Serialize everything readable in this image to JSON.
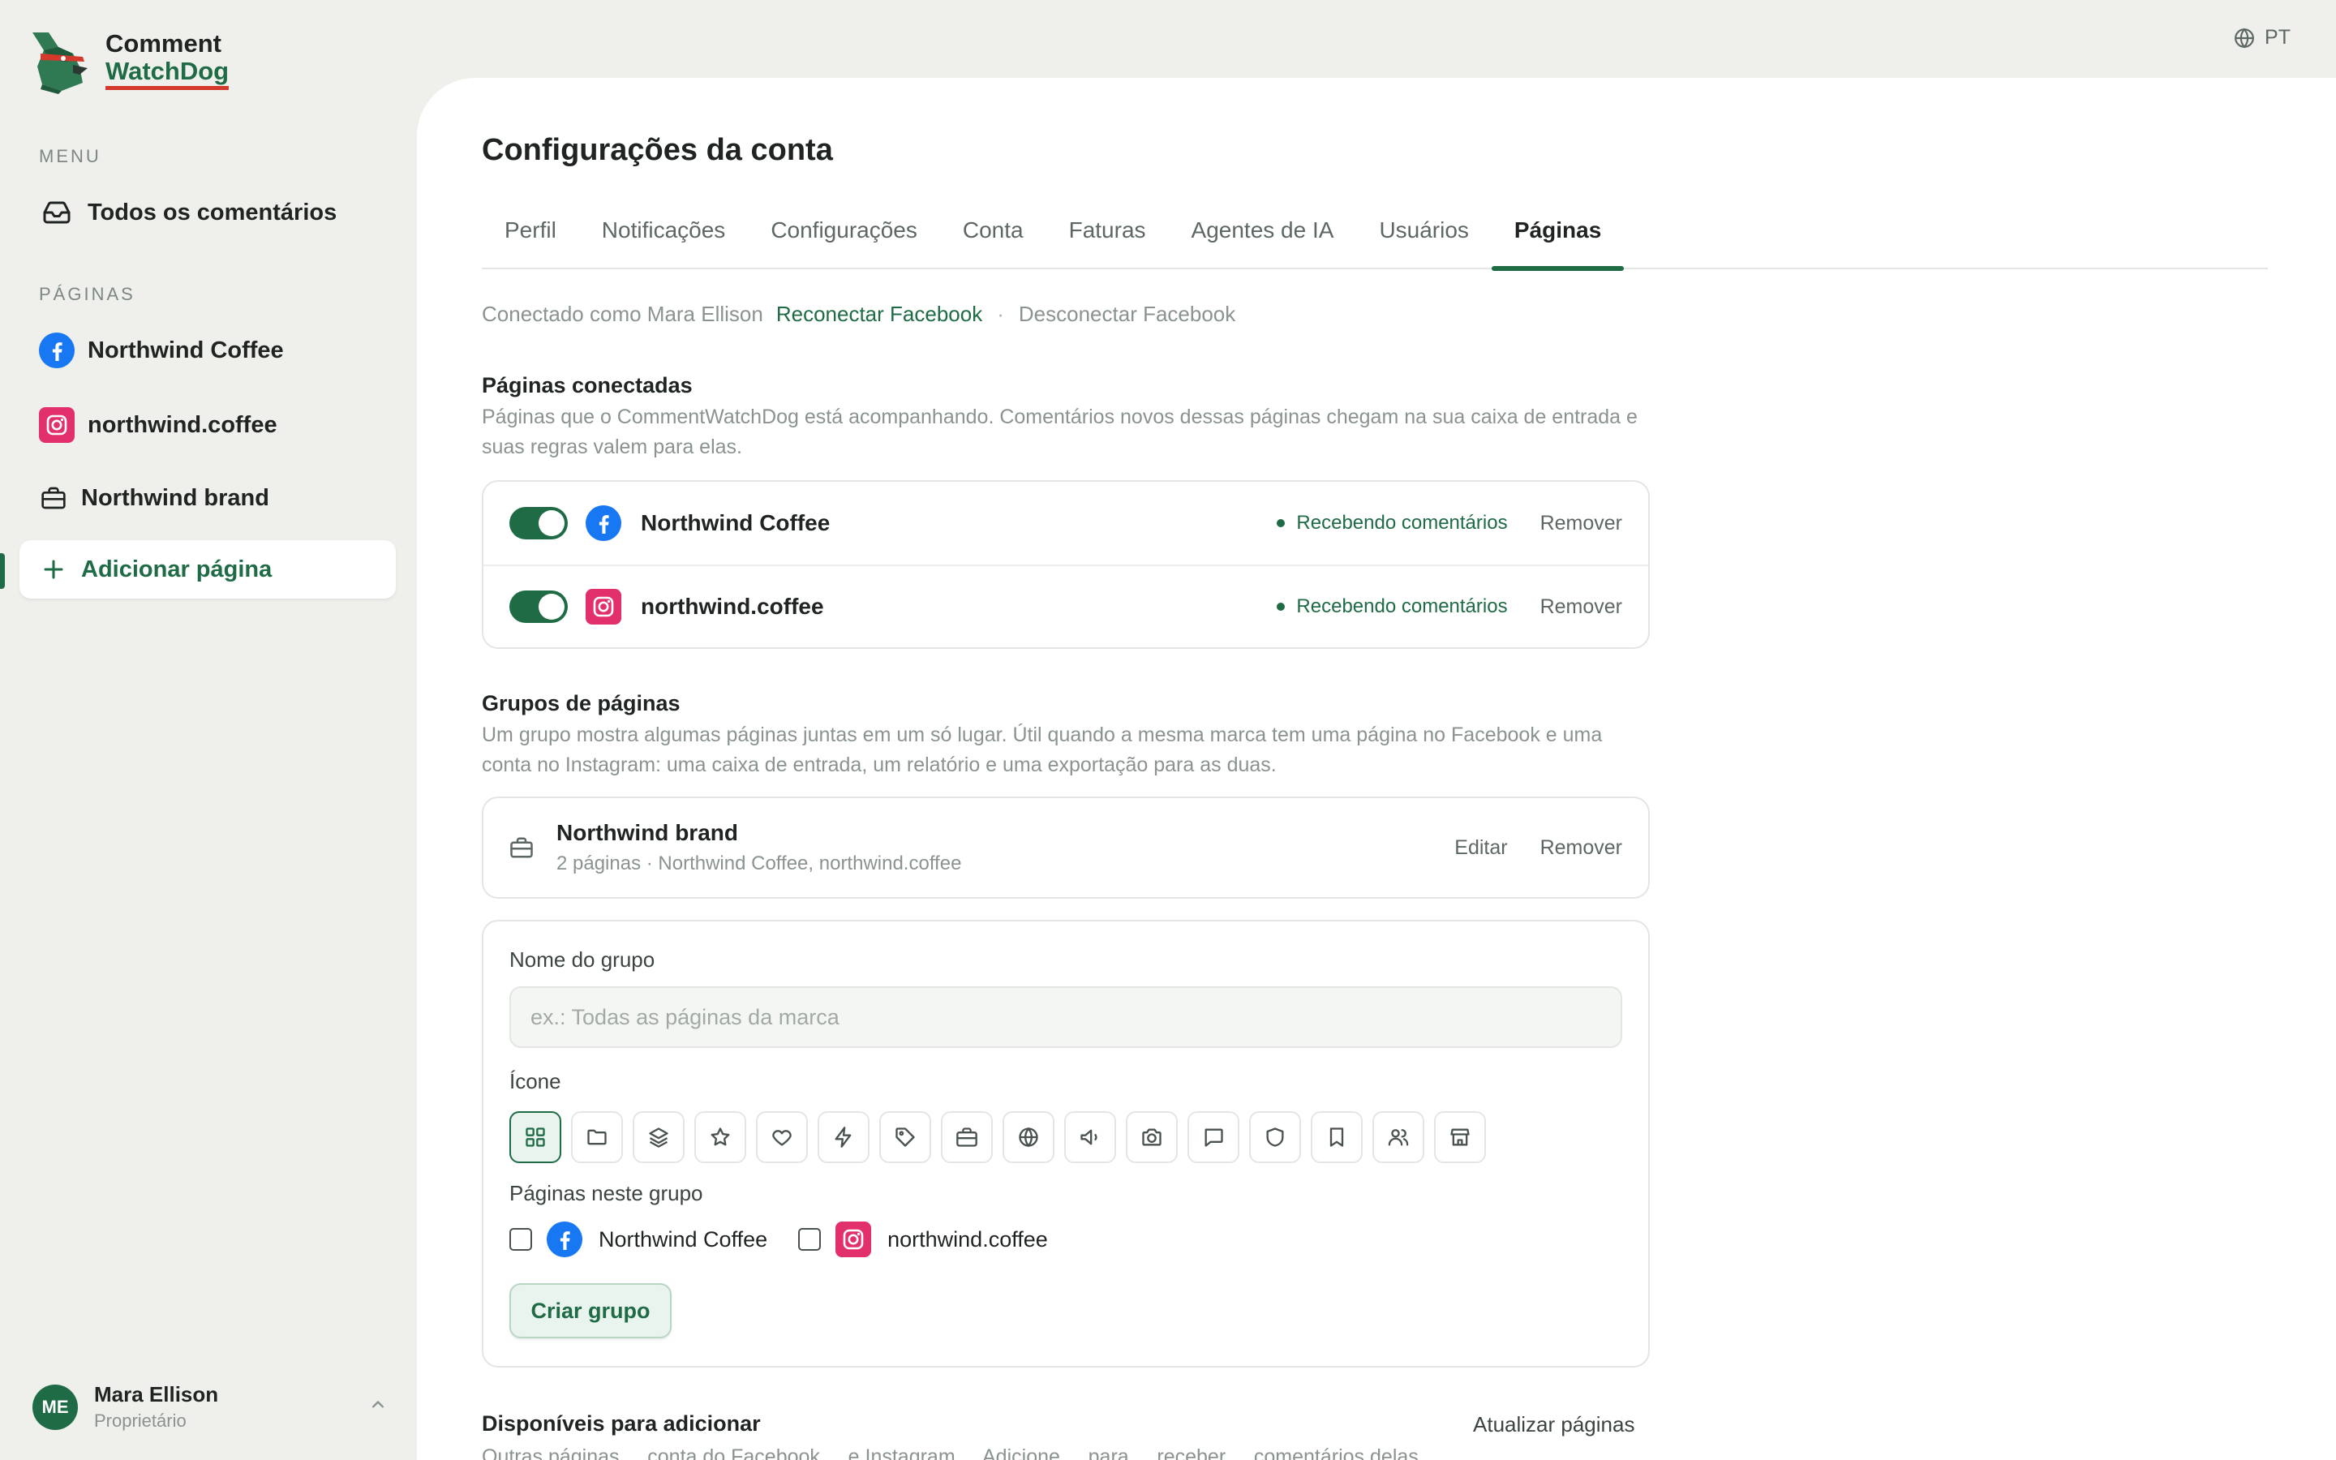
{
  "brand": {
    "line1": "Comment",
    "line2": "WatchDog"
  },
  "language": "PT",
  "sidebar": {
    "menu_label": "MENU",
    "all_comments": "Todos os comentários",
    "pages_label": "PÁGINAS",
    "pages": [
      {
        "label": "Northwind Coffee",
        "icon": "facebook-icon"
      },
      {
        "label": "northwind.coffee",
        "icon": "instagram-icon"
      },
      {
        "label": "Northwind brand",
        "icon": "briefcase-icon"
      }
    ],
    "add_page": "Adicionar página"
  },
  "user": {
    "initials": "ME",
    "name": "Mara Ellison",
    "role": "Proprietário"
  },
  "main": {
    "title": "Configurações da conta",
    "tabs": [
      {
        "label": "Perfil"
      },
      {
        "label": "Notificações"
      },
      {
        "label": "Configurações"
      },
      {
        "label": "Conta"
      },
      {
        "label": "Faturas"
      },
      {
        "label": "Agentes de IA"
      },
      {
        "label": "Usuários"
      },
      {
        "label": "Páginas",
        "active": true
      }
    ],
    "connection": {
      "text": "Conectado como Mara Ellison",
      "reconnect": "Reconectar Facebook",
      "separator": "·",
      "disconnect": "Desconectar Facebook"
    },
    "connected": {
      "title": "Páginas conectadas",
      "description": "Páginas que o CommentWatchDog está acompanhando. Comentários novos dessas páginas chegam na sua caixa de entrada e suas regras valem para elas.",
      "pages": [
        {
          "name": "Northwind Coffee",
          "platform": "facebook",
          "status": "Recebendo comentários",
          "remove": "Remover"
        },
        {
          "name": "northwind.coffee",
          "platform": "instagram",
          "status": "Recebendo comentários",
          "remove": "Remover"
        }
      ]
    },
    "groups": {
      "title": "Grupos de páginas",
      "description": "Um grupo mostra algumas páginas juntas em um só lugar. Útil quando a mesma marca tem uma página no Facebook e uma conta no Instagram: uma caixa de entrada, um relatório e uma exportação para as duas.",
      "items": [
        {
          "name": "Northwind brand",
          "subtitle": "2 páginas · Northwind Coffee, northwind.coffee",
          "edit": "Editar",
          "remove": "Remover"
        }
      ],
      "form": {
        "name_label": "Nome do grupo",
        "name_placeholder": "ex.: Todas as páginas da marca",
        "icon_label": "Ícone",
        "icons": [
          "grid-icon",
          "folder-icon",
          "layers-icon",
          "star-icon",
          "heart-icon",
          "bolt-icon",
          "tag-icon",
          "briefcase-icon",
          "globe-icon",
          "megaphone-icon",
          "camera-icon",
          "chat-icon",
          "shield-icon",
          "bookmark-icon",
          "users-icon",
          "store-icon"
        ],
        "pages_label": "Páginas neste grupo",
        "pages": [
          {
            "label": "Northwind Coffee"
          },
          {
            "label": "northwind.coffee"
          }
        ],
        "create_button": "Criar grupo"
      }
    },
    "available": {
      "title": "Disponíveis para adicionar",
      "refresh": "Atualizar páginas",
      "description_partial": "Outras páginas ... conta do Facebook ... e Instagram ... Adicione ... para ... receber ... comentários delas"
    }
  },
  "colors": {
    "accent": "#1e6b45",
    "facebook": "#1877f2",
    "instagram": "#e1306c",
    "logo_underline": "#d33a2c"
  }
}
